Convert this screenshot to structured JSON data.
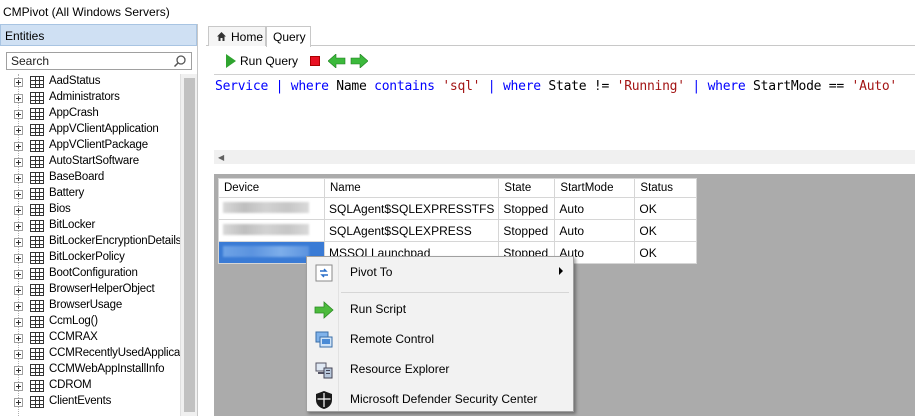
{
  "window": {
    "title": "CMPivot (All Windows Servers)"
  },
  "entities": {
    "header": "Entities",
    "search_placeholder": "Search",
    "items": [
      "AadStatus",
      "Administrators",
      "AppCrash",
      "AppVClientApplication",
      "AppVClientPackage",
      "AutoStartSoftware",
      "BaseBoard",
      "Battery",
      "Bios",
      "BitLocker",
      "BitLockerEncryptionDetails",
      "BitLockerPolicy",
      "BootConfiguration",
      "BrowserHelperObject",
      "BrowserUsage",
      "CcmLog()",
      "CCMRAX",
      "CCMRecentlyUsedApplicat",
      "CCMWebAppInstallInfo",
      "CDROM",
      "ClientEvents"
    ]
  },
  "tabs": {
    "home": "Home",
    "query": "Query"
  },
  "toolbar": {
    "run_label": "Run Query"
  },
  "query": {
    "tokens": [
      {
        "t": "Service",
        "c": "k"
      },
      {
        "t": " | ",
        "c": "k"
      },
      {
        "t": "where",
        "c": "k"
      },
      {
        "t": " Name ",
        "c": "p"
      },
      {
        "t": "contains",
        "c": "k"
      },
      {
        "t": " ",
        "c": "p"
      },
      {
        "t": "'sql'",
        "c": "s"
      },
      {
        "t": " | ",
        "c": "k"
      },
      {
        "t": "where",
        "c": "k"
      },
      {
        "t": " State != ",
        "c": "p"
      },
      {
        "t": "'Running'",
        "c": "s"
      },
      {
        "t": " | ",
        "c": "k"
      },
      {
        "t": "where",
        "c": "k"
      },
      {
        "t": " StartMode == ",
        "c": "p"
      },
      {
        "t": "'Auto'",
        "c": "s"
      }
    ]
  },
  "results": {
    "columns": [
      "Device",
      "Name",
      "State",
      "StartMode",
      "Status"
    ],
    "rows": [
      {
        "name": "SQLAgent$SQLEXPRESSTFS",
        "state": "Stopped",
        "startmode": "Auto",
        "status": "OK"
      },
      {
        "name": "SQLAgent$SQLEXPRESS",
        "state": "Stopped",
        "startmode": "Auto",
        "status": "OK"
      },
      {
        "name": "MSSQLLaunchpad",
        "state": "Stopped",
        "startmode": "Auto",
        "status": "OK"
      }
    ]
  },
  "context_menu": {
    "items": [
      {
        "label": "Pivot To",
        "icon": "pivot-icon"
      },
      {
        "label": "Run Script",
        "icon": "run-script-icon"
      },
      {
        "label": "Remote Control",
        "icon": "remote-control-icon"
      },
      {
        "label": "Resource Explorer",
        "icon": "resource-explorer-icon"
      },
      {
        "label": "Microsoft Defender Security Center",
        "icon": "defender-shield-icon"
      }
    ]
  },
  "colors": {
    "accent": "#3a7bd5",
    "run_green": "#2fa42f",
    "stop_red": "#e81123",
    "keyword_blue": "#0000ff",
    "string_red": "#a31515",
    "results_bg": "#ababab"
  }
}
